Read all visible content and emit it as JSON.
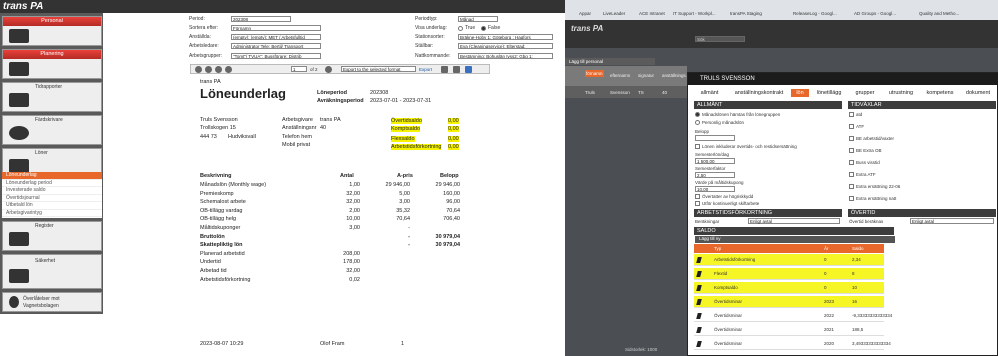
{
  "left_app": {
    "logo": "trans PA",
    "sidebar": {
      "sections": [
        {
          "title": "Personal"
        },
        {
          "title": "Planering"
        },
        {
          "title": "Tidrapporter"
        },
        {
          "title": "Färdskrivare"
        },
        {
          "title": "Löner"
        },
        {
          "title": "Register"
        },
        {
          "title": "Säkerhet"
        },
        {
          "title": "Överlåtelser mot",
          "subtitle": "Vagnetsbolagen"
        }
      ],
      "loner_items": [
        "Löneunderlag",
        "Löneunderlag period",
        "Investerade saldo",
        "Övertidsjournal",
        "Utbetald lön",
        "Arbetsgivarintyg"
      ]
    },
    "filters": {
      "period_label": "Period:",
      "period_value": "202308",
      "sortera_label": "Sortera efter:",
      "sortera_value": "Förnamn",
      "anstallda_label": "Anställda:",
      "anstallda_value": "(empty); (empty); MET / Arbetsfulltid",
      "arbetsledare_label": "Arbetsledare:",
      "arbetsledare_value": "Administrator Tele; Bertil/ Transport",
      "arbetsgrupper_label": "Arbetsgrupper:",
      "arbetsgrupper_value": "\"Tomt\"/ TVUA\"; Bussförare; Distrib",
      "periodtyp_label": "Periodtyp:",
      "periodtyp_value": "Månad",
      "visa_label": "Visa underlag:",
      "visa_true": "True",
      "visa_false": "False",
      "station_label": "Stationsorter:",
      "station_value": "Bräkne-Hoby 1; Göteborg ; Hagfors",
      "stallbar_label": "Ställbar:",
      "stallbar_value": "Eva (Cleaningservice); Elterstad;",
      "nattkommande_label": "Nattkommande:",
      "nattkommande_value": "Bestämning; Bohuslän Ivss2; Gbg 1;"
    },
    "toolbar": {
      "page": "1",
      "of": "of 2",
      "export_select": "Export to the selected format",
      "export_label": "Export"
    },
    "report": {
      "brand": "trans PA",
      "title": "Löneunderlag",
      "loneperiod_label": "Löneperiod",
      "loneperiod_value": "202308",
      "avrakning_label": "Avräkningsperiod",
      "avrakning_value": "2023-07-01 - 2023-07-31",
      "employee_name": "Truls Svensson",
      "street": "Trollskogen 15",
      "postal": "444 73",
      "city": "Hudviksvall",
      "arbetsgivare_label": "Arbetsgivare",
      "arbetsgivare_value": "trans PA",
      "anst_label": "Anställningsnr",
      "anst_value": "40",
      "telefon_label": "Telefon hem",
      "mobil_label": "Mobil privat",
      "saldos": [
        {
          "label": "Övertidsaldo",
          "value": "0,00"
        },
        {
          "label": "Komptsaldo",
          "value": "0,00"
        },
        {
          "label": "Flexsaldo",
          "value": "0,00"
        },
        {
          "label": "Arbetstidsförkortning",
          "value": "0,00"
        }
      ],
      "columns": [
        "Beskrivning",
        "Antal",
        "A-pris",
        "Belopp"
      ],
      "rows": [
        {
          "desc": "Månadslön (Monthly wage)",
          "antal": "1,00",
          "apris": "29 946,00",
          "belopp": "29 946,00",
          "bold": false
        },
        {
          "desc": "Premieskomp",
          "antal": "32,00",
          "apris": "5,00",
          "belopp": "160,00",
          "bold": false
        },
        {
          "desc": "Schemalost arbete",
          "antal": "32,00",
          "apris": "3,00",
          "belopp": "96,00",
          "bold": false
        },
        {
          "desc": "OB-tillägg vardag",
          "antal": "2,00",
          "apris": "35,32",
          "belopp": "70,64",
          "bold": false
        },
        {
          "desc": "OB-tillägg helg",
          "antal": "10,00",
          "apris": "70,64",
          "belopp": "706,40",
          "bold": false
        },
        {
          "desc": "Måltidskuponger",
          "antal": "3,00",
          "apris": "-",
          "belopp": "",
          "bold": false
        },
        {
          "desc": "Bruttolön",
          "antal": "",
          "apris": "-",
          "belopp": "30 979,04",
          "bold": true
        },
        {
          "desc": "Skattepliktig lön",
          "antal": "",
          "apris": "-",
          "belopp": "30 979,04",
          "bold": true
        },
        {
          "desc": "Planerad arbetstid",
          "antal": "208,00",
          "apris": "",
          "belopp": "",
          "bold": false
        },
        {
          "desc": "Undertid",
          "antal": "178,00",
          "apris": "",
          "belopp": "",
          "bold": false
        },
        {
          "desc": "Arbetad tid",
          "antal": "32,00",
          "apris": "",
          "belopp": "",
          "bold": false
        },
        {
          "desc": "Arbetstidsförkortning",
          "antal": "0,02",
          "apris": "",
          "belopp": "",
          "bold": false
        }
      ],
      "footer_date": "2023-08-07 10:29",
      "footer_user": "Olof Fram",
      "footer_page": "1"
    }
  },
  "right_app": {
    "bookmarks": [
      "Appar",
      "LiveLeader",
      "ACE Intranet",
      "IT Support - Workpl...",
      "transPA Staging",
      "ReleaseLog - Googl...",
      "AD Groups - Googl...",
      "Quality and Metho..."
    ],
    "search_placeholder": "Sök",
    "add_personal": "Lägg till personal",
    "grid_columns": [
      "förnamn",
      "efternamn",
      "signatur",
      "anställnings..."
    ],
    "grid_row": {
      "fornamn": "Truls",
      "efternamn": "Svensson",
      "signatur": "TS",
      "nr": "40"
    },
    "dialog": {
      "title": "TRULS SVENSSON",
      "tabs": [
        "allmänt",
        "anställningskontrakt",
        "lön",
        "lönetillägg",
        "grupper",
        "utrustning",
        "kompetens",
        "dokument"
      ],
      "active_tab": "lön",
      "allmant_head": "ALLMÄNT",
      "radio1": "Månadslönen hämtas från lönegruppen",
      "radio2": "Personlig månadslön",
      "belopp_label": "Belopp",
      "lonen_cb": "Lönen inkluderar övertids- och restidsersättning",
      "semesterlon_label": "Semesterlön/dag",
      "semesterlon_value": "1 500,00",
      "semesterfaktor_label": "Semesterfaktor",
      "semesterfaktor_value": "2,50",
      "varde_label": "Värde på måltidskupong",
      "varde_value": "10,00",
      "ovtid_cb": "Övertatter av högriskkydd",
      "utfor_cb": "Utför kontinuerligt skiftarbete",
      "tidsvaxlar_head": "TIDVÄXLAR",
      "tidsvaxlar": [
        "atd",
        "ATF",
        "BE arbetstid/vaxter",
        "BE Extra OB",
        "Buss visstid",
        "Extra ATF",
        "Extra ersättning 22-06",
        "Extra ersättning natt"
      ],
      "atk_head": "ARBETSTIDSFÖRKORTNING",
      "berakningar_label": "Beräkningar",
      "berakningar_value": "Enligt avtal",
      "overtid_head": "ÖVERTID",
      "overtid_label": "Övertid beräknas",
      "overtid_value": "Enligt avtal",
      "saldo_head": "SALDO",
      "saldo_add": "Lägg till ny",
      "saldo_cols": [
        "Typ",
        "År",
        "Saldo"
      ],
      "saldo_rows": [
        {
          "typ": "Arbetstidsförkortning",
          "ar": "0",
          "saldo": "2,34"
        },
        {
          "typ": "Flextid",
          "ar": "0",
          "saldo": "8"
        },
        {
          "typ": "Komptsaldo",
          "ar": "0",
          "saldo": "10"
        },
        {
          "typ": "Övertidsminar",
          "ar": "2023",
          "saldo": "16"
        },
        {
          "typ": "Övertidsminar",
          "ar": "2022",
          "saldo": "-9,33333333333334"
        },
        {
          "typ": "Övertidsminar",
          "ar": "2021",
          "saldo": "188,5"
        },
        {
          "typ": "Övertidsminar",
          "ar": "2020",
          "saldo": "3,49333333333334"
        }
      ]
    },
    "pager": "Sidstorlek: 1000"
  },
  "colors": {
    "accent": "#e8672a",
    "highlight": "#f5f300",
    "sidebar_head": "#e8413a",
    "dark": "#1b1b1b"
  }
}
